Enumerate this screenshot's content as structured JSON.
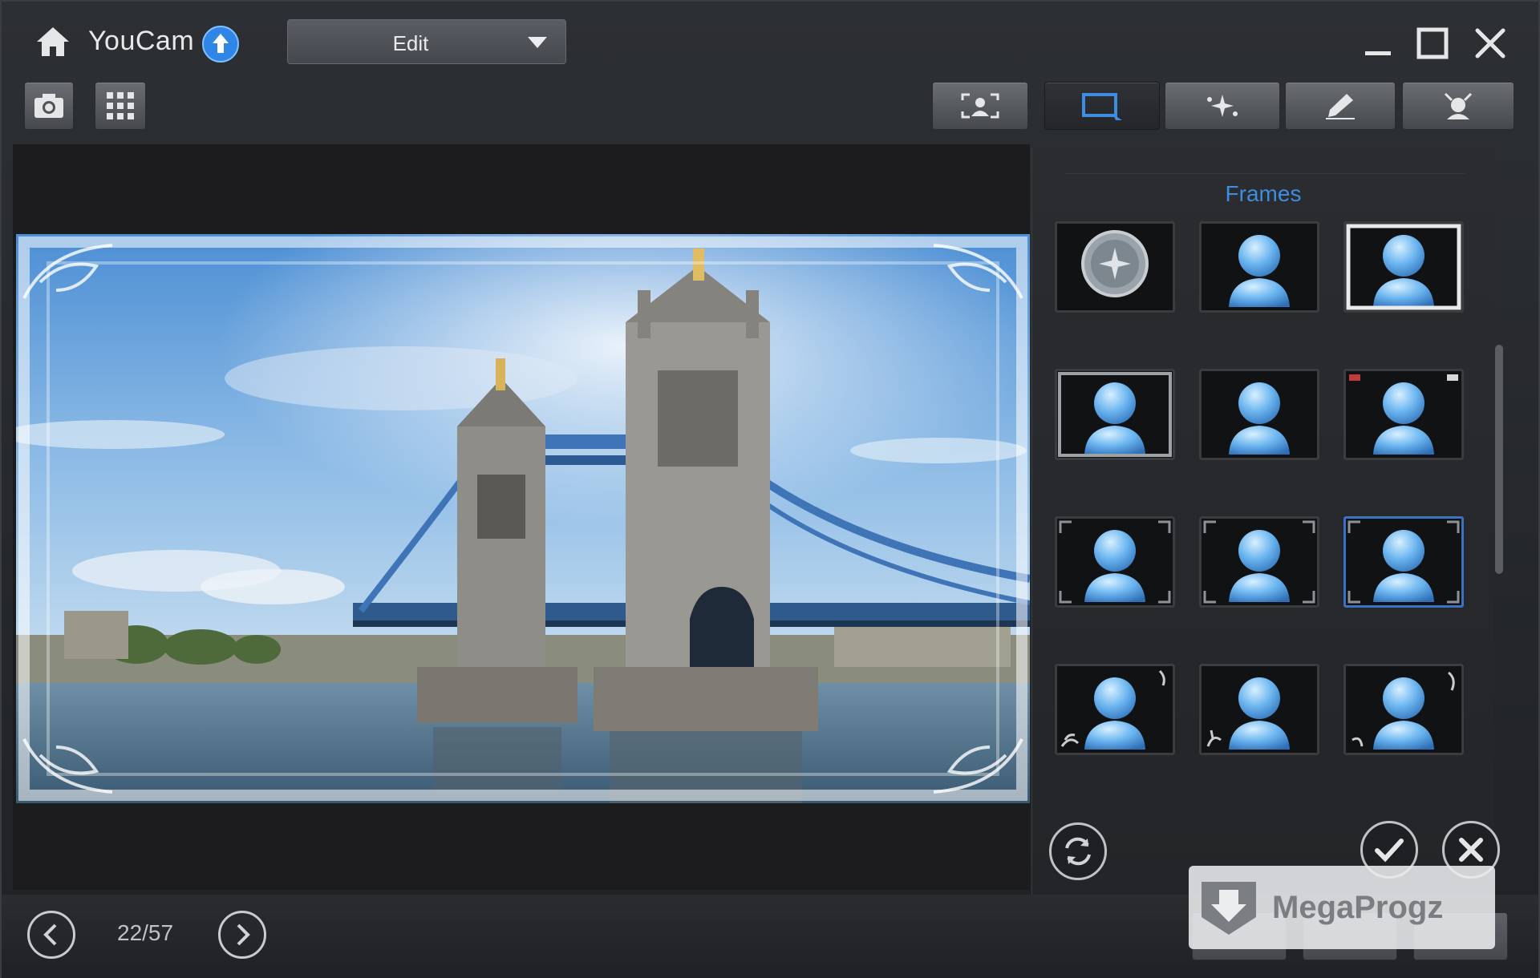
{
  "titlebar": {
    "app_name": "YouCam",
    "mode_selected": "Edit"
  },
  "panel": {
    "title": "Frames",
    "frames": [
      {
        "style": "round",
        "selected": false
      },
      {
        "style": "plain",
        "selected": false
      },
      {
        "style": "white-border",
        "selected": false
      },
      {
        "style": "silver-border",
        "selected": false
      },
      {
        "style": "dark-plain",
        "selected": false
      },
      {
        "style": "corner-tabs",
        "selected": false
      },
      {
        "style": "corner-brackets",
        "selected": false
      },
      {
        "style": "dark-corners",
        "selected": false
      },
      {
        "style": "blue-corners",
        "selected": true
      },
      {
        "style": "floral-left",
        "selected": false
      },
      {
        "style": "floral-bottom",
        "selected": false
      },
      {
        "style": "floral-right",
        "selected": false
      }
    ]
  },
  "navigation": {
    "page_counter": "22/57"
  },
  "watermark": {
    "text": "MegaProgz"
  },
  "colors": {
    "accent": "#3d8de0",
    "selected_border": "#3b72c4",
    "background": "#1b1c1f"
  }
}
